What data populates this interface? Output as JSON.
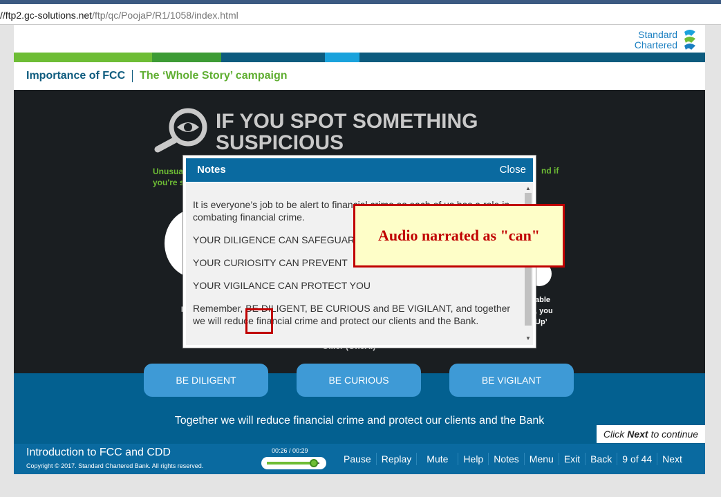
{
  "browser": {
    "url_host": "//ftp2.gc-solutions.net",
    "url_path": "/ftp/qc/PoojaP/R1/1058/index.html"
  },
  "brand": {
    "logo_line1": "Standard",
    "logo_line2": "Chartered",
    "colors": {
      "green": "#6ebd35",
      "dark_green": "#3d9b35",
      "navy": "#0d5b7e",
      "light_blue": "#1aa2dc",
      "blue": "#0a6aa0"
    }
  },
  "nav": {
    "section": "Importance of FCC",
    "topic": "The ‘Whole Story’ campaign"
  },
  "slide": {
    "heading_line1": "IF YOU SPOT SOMETHING",
    "heading_line2": "SUSPICIOUS",
    "green_left": "Unusua you're s",
    "green_right": "nd if",
    "white_right_line1": "able",
    "white_right_line2": ", you",
    "white_right_line3": "Up’",
    "white_left_fragment": "I",
    "cut_text": "Ollier (OneAI)",
    "buttons": [
      "BE DILIGENT",
      "BE CURIOUS",
      "BE VIGILANT"
    ],
    "tagline": "Together we will reduce financial crime and protect our clients and the Bank",
    "continue_pre": "Click",
    "continue_bold": "Next",
    "continue_post": "to continue"
  },
  "notes": {
    "title": "Notes",
    "close_label": "Close",
    "paragraphs": [
      "It is everyone’s job to be alert to financial crime as each of us has a role in combating financial crime.",
      "YOUR DILIGENCE CAN SAFEGUARD",
      "YOUR CURIOSITY CAN PREVENT",
      "YOUR VIGILANCE CAN PROTECT YOU",
      "Remember, BE DILIGENT, BE CURIOUS and BE VIGILANT, and together we will reduce financial crime and protect our clients and the Bank."
    ]
  },
  "annotation": {
    "callout_text": "Audio narrated as \"can\""
  },
  "footer": {
    "course_title": "Introduction to FCC and CDD",
    "copyright": "Copyright © 2017. Standard Chartered Bank. All rights reserved.",
    "time_display": "00:26 / 00:29",
    "progress": 0.897,
    "controls": [
      "Pause",
      "Replay",
      "Mute",
      "Help",
      "Notes",
      "Menu",
      "Exit",
      "Back",
      "9 of 44",
      "Next"
    ]
  }
}
